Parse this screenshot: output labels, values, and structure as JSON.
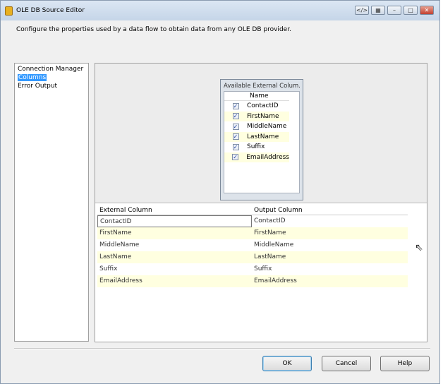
{
  "window": {
    "title": "OLE DB Source Editor",
    "description": "Configure the properties used by a data flow to obtain data from any OLE DB provider."
  },
  "nav": {
    "items": [
      {
        "label": "Connection Manager"
      },
      {
        "label": "Columns",
        "selected": true
      },
      {
        "label": "Error Output"
      }
    ]
  },
  "available": {
    "title": "Available External Colum...",
    "header": "Name",
    "items": [
      {
        "name": "ContactID",
        "checked": true
      },
      {
        "name": "FirstName",
        "checked": true
      },
      {
        "name": "MiddleName",
        "checked": true
      },
      {
        "name": "LastName",
        "checked": true
      },
      {
        "name": "Suffix",
        "checked": true
      },
      {
        "name": "EmailAddress",
        "checked": true
      }
    ]
  },
  "mapping": {
    "headers": [
      "External Column",
      "Output Column"
    ],
    "rows": [
      [
        "ContactID",
        "ContactID"
      ],
      [
        "FirstName",
        "FirstName"
      ],
      [
        "MiddleName",
        "MiddleName"
      ],
      [
        "LastName",
        "LastName"
      ],
      [
        "Suffix",
        "Suffix"
      ],
      [
        "EmailAddress",
        "EmailAddress"
      ]
    ]
  },
  "buttons": {
    "ok": "OK",
    "cancel": "Cancel",
    "help": "Help"
  },
  "colors": {
    "selection": "#3399ff",
    "alt_row": "#ffffe0"
  }
}
